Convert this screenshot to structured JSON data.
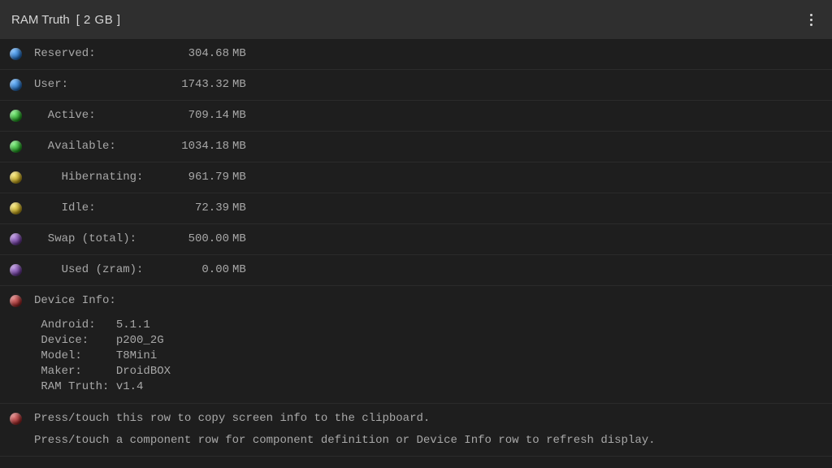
{
  "title": {
    "app": "RAM Truth",
    "size": "[ 2 GB ]"
  },
  "rows": [
    {
      "dot": "blue",
      "label": "Reserved:",
      "value": "304.68",
      "unit": "MB",
      "indent": 0
    },
    {
      "dot": "blue",
      "label": "User:",
      "value": "1743.32",
      "unit": "MB",
      "indent": 0
    },
    {
      "dot": "green",
      "label": "Active:",
      "value": "709.14",
      "unit": "MB",
      "indent": 1
    },
    {
      "dot": "green",
      "label": "Available:",
      "value": "1034.18",
      "unit": "MB",
      "indent": 1
    },
    {
      "dot": "yellow",
      "label": "Hibernating:",
      "value": "961.79",
      "unit": "MB",
      "indent": 2
    },
    {
      "dot": "yellow",
      "label": "Idle:",
      "value": "72.39",
      "unit": "MB",
      "indent": 2
    },
    {
      "dot": "purple",
      "label": "Swap (total):",
      "value": "500.00",
      "unit": "MB",
      "indent": 1
    },
    {
      "dot": "purple",
      "label": "Used (zram):",
      "value": "0.00",
      "unit": "MB",
      "indent": 2
    }
  ],
  "device": {
    "header": "Device Info:",
    "lines": [
      {
        "k": "Android:",
        "v": "5.1.1"
      },
      {
        "k": "Device:",
        "v": "p200_2G"
      },
      {
        "k": "Model:",
        "v": "T8Mini"
      },
      {
        "k": "Maker:",
        "v": "DroidBOX"
      },
      {
        "k": "RAM Truth:",
        "v": "v1.4"
      }
    ]
  },
  "hints": {
    "line1": "Press/touch this row to copy screen info to the clipboard.",
    "line2": "Press/touch a component row for component definition or Device Info row to refresh display."
  }
}
